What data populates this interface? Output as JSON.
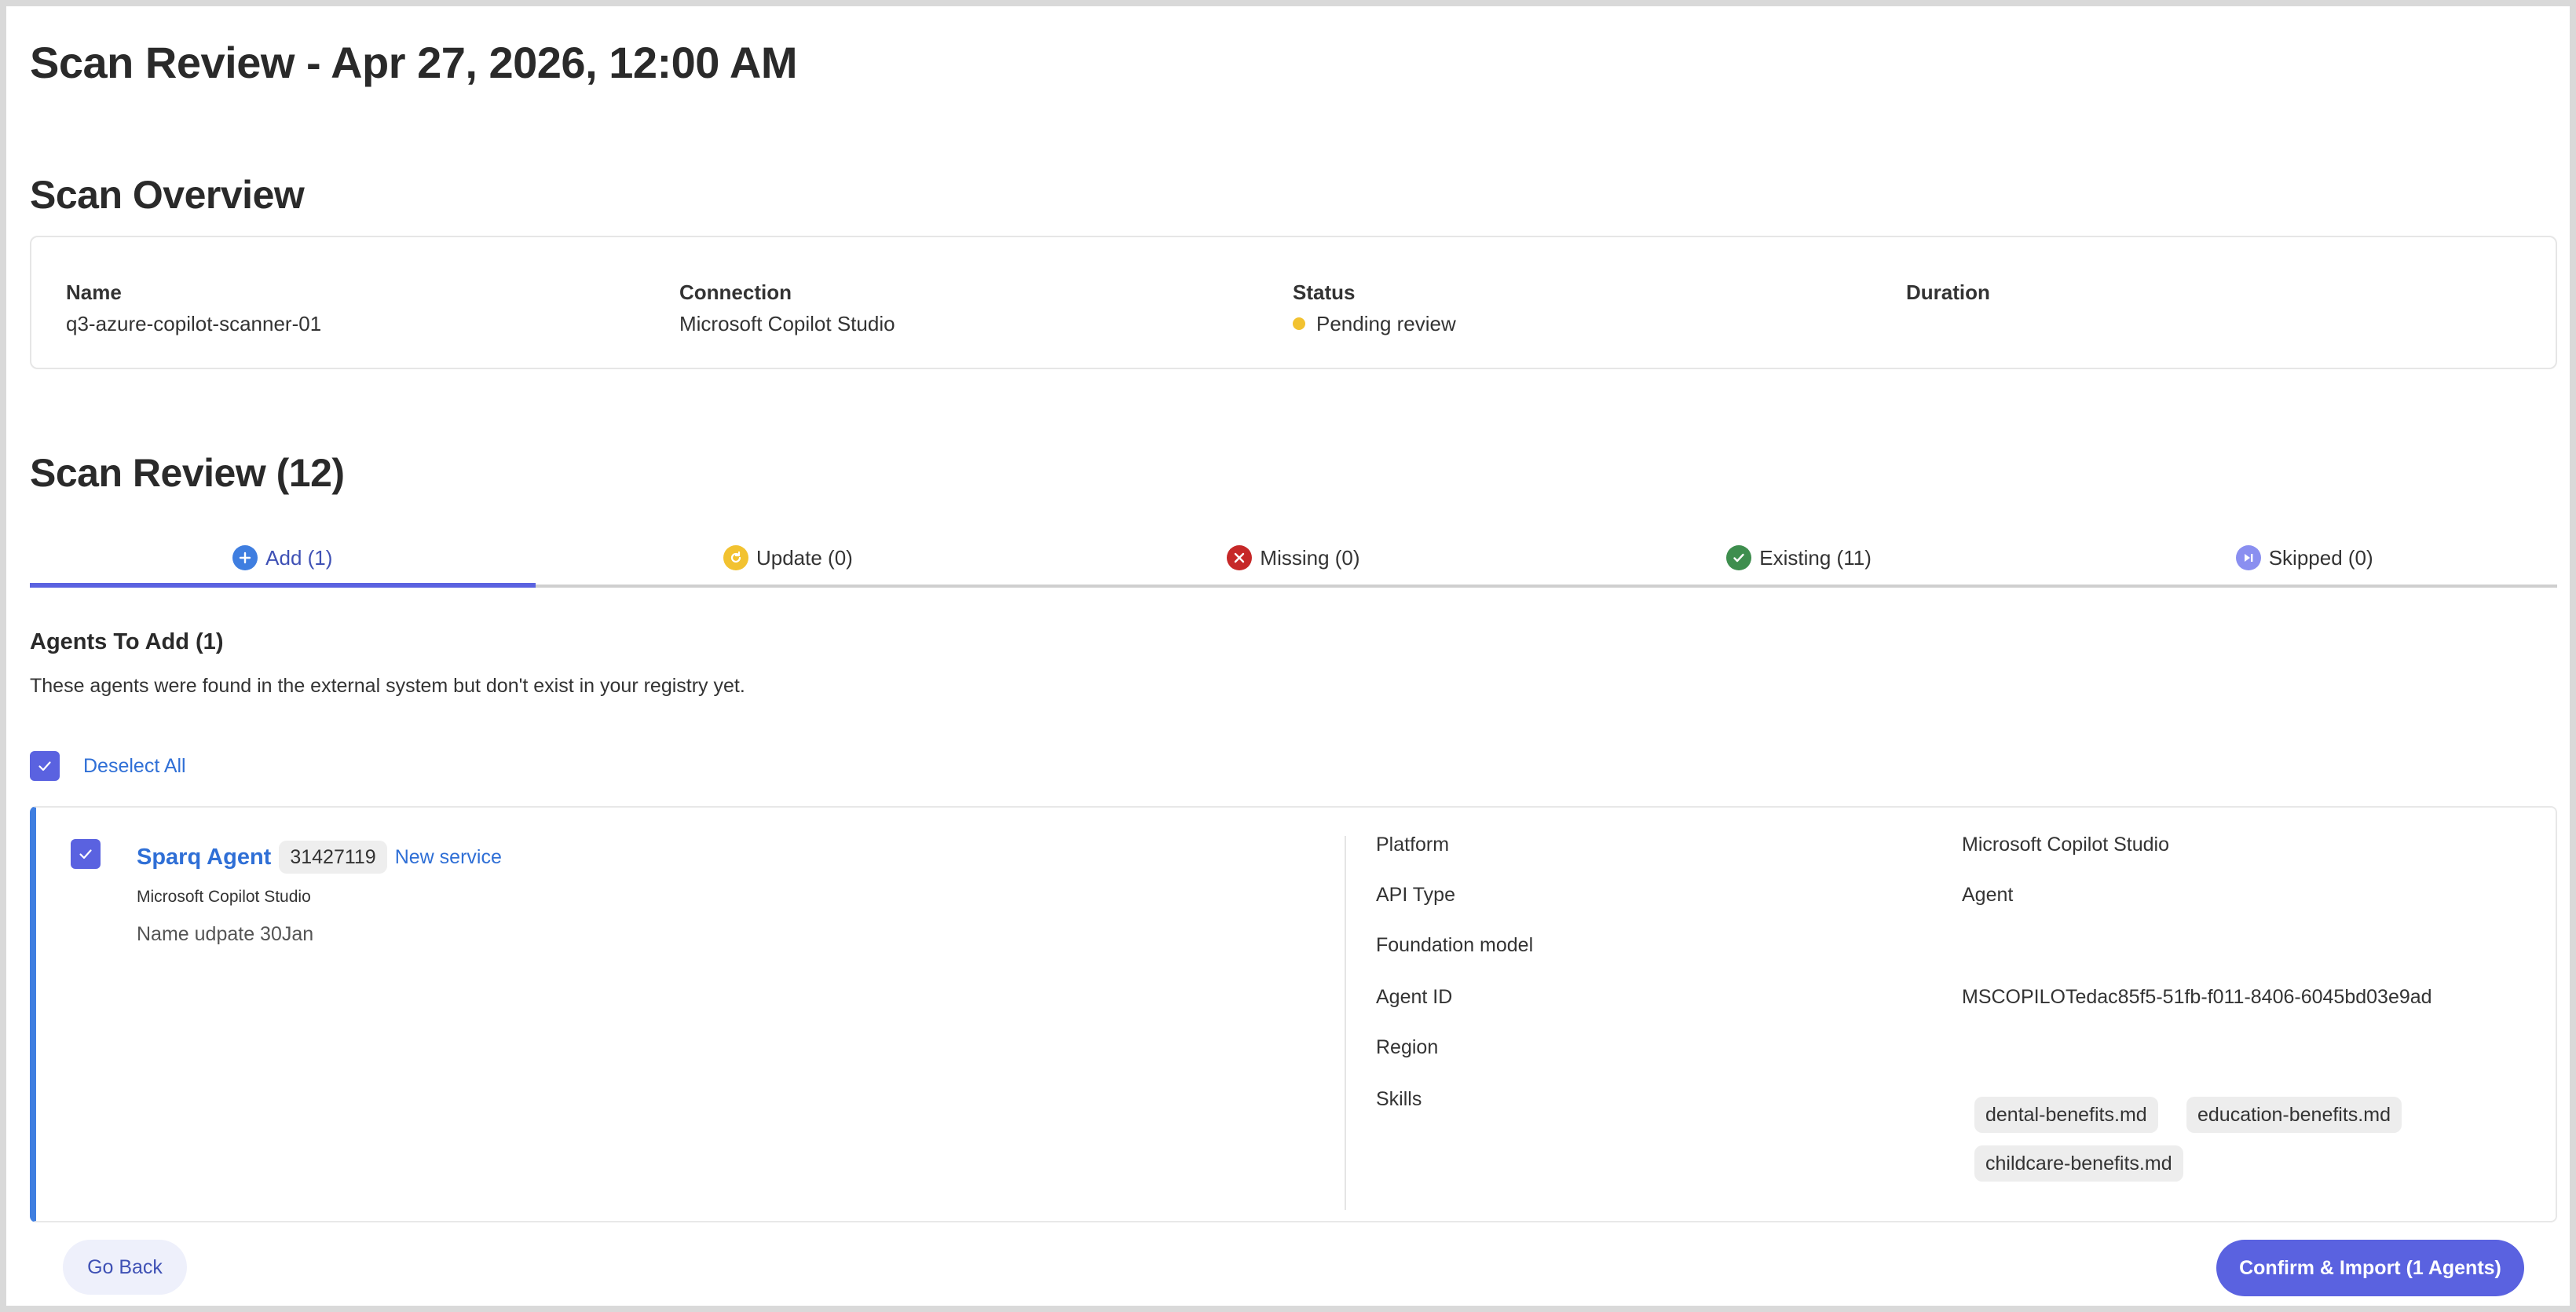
{
  "page": {
    "title": "Scan Review - Apr 27, 2026, 12:00 AM"
  },
  "overview": {
    "title": "Scan Overview",
    "fields": [
      {
        "label": "Name",
        "value": "q3-azure-copilot-scanner-01"
      },
      {
        "label": "Connection",
        "value": "Microsoft Copilot Studio"
      },
      {
        "label": "Status",
        "value": "Pending review"
      },
      {
        "label": "Duration",
        "value": ""
      }
    ],
    "status_color": "#f2c230"
  },
  "review": {
    "title": "Scan Review (12)",
    "tabs": [
      {
        "label": "Add (1)",
        "icon": "plus-circle-icon",
        "color": "#3f7ee0",
        "active": true
      },
      {
        "label": "Update (0)",
        "icon": "refresh-circle-icon",
        "color": "#f2c230",
        "active": false
      },
      {
        "label": "Missing (0)",
        "icon": "x-circle-icon",
        "color": "#c62828",
        "active": false
      },
      {
        "label": "Existing (11)",
        "icon": "check-circle-icon",
        "color": "#3e8e4e",
        "active": false
      },
      {
        "label": "Skipped (0)",
        "icon": "skip-circle-icon",
        "color": "#8a8ff0",
        "active": false
      }
    ],
    "subheading": "Agents To Add (1)",
    "description": "These agents were found in the external system but don't exist in your registry yet.",
    "deselect_all": "Deselect All"
  },
  "agent": {
    "name": "Sparq Agent",
    "id": "31427119",
    "tag": "New service",
    "platform": "Microsoft Copilot Studio",
    "description": "Name udpate 30Jan",
    "details": [
      {
        "label": "Platform",
        "value": "Microsoft Copilot Studio"
      },
      {
        "label": "API Type",
        "value": "Agent"
      },
      {
        "label": "Foundation model",
        "value": ""
      },
      {
        "label": "Agent ID",
        "value": "MSCOPILOTedac85f5-51fb-f011-8406-6045bd03e9ad"
      },
      {
        "label": "Region",
        "value": ""
      },
      {
        "label": "Skills",
        "value": ""
      }
    ],
    "skills": [
      "dental-benefits.md",
      "education-benefits.md",
      "childcare-benefits.md"
    ]
  },
  "footer": {
    "go_back": "Go Back",
    "confirm": "Confirm & Import (1 Agents)"
  },
  "colors": {
    "accent": "#5a62e0",
    "link": "#2f6fd6",
    "card_accent": "#3f7ee0"
  }
}
